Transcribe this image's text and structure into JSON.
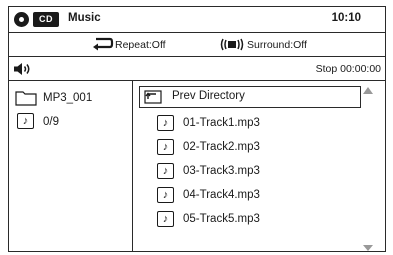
{
  "header": {
    "title": "Music",
    "cd_badge": "CD",
    "time": "10:10"
  },
  "modes": {
    "repeat": "Repeat:Off",
    "surround": "Surround:Off"
  },
  "status": {
    "playstate": "Stop 00:00:00"
  },
  "left": {
    "folder": "MP3_001",
    "count": "0/9"
  },
  "list": {
    "prev_dir": "Prev Directory",
    "tracks": [
      "01-Track1.mp3",
      "02-Track2.mp3",
      "03-Track3.mp3",
      "04-Track4.mp3",
      "05-Track5.mp3"
    ]
  },
  "icons": {
    "disc": "disc-icon",
    "repeat": "repeat-icon",
    "surround": "surround-icon",
    "speaker": "speaker-icon",
    "folder": "folder-icon",
    "music_file": "music-note-icon",
    "parent_dir": "parent-directory-icon",
    "scroll_up": "scroll-up-arrow-icon",
    "scroll_down": "scroll-down-arrow-icon"
  }
}
